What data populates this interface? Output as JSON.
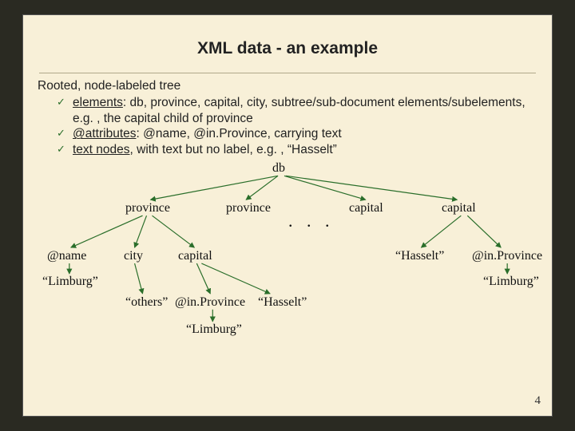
{
  "title": "XML data - an example",
  "lead": "Rooted, node-labeled tree",
  "bullets": [
    {
      "pre": "",
      "u": "elements",
      "post": ": db, province, capital, city, subtree/sub-document elements/subelements, e.g. , the capital child of province"
    },
    {
      "pre": "",
      "u": "@attributes",
      "post": ": @name, @in.Province, carrying text"
    },
    {
      "pre": "",
      "u": "text nodes",
      "post": ", with text but no label, e.g. , “Hasselt”"
    }
  ],
  "tree": {
    "root": "db",
    "level1": [
      "province",
      "province",
      "capital",
      "capital"
    ],
    "ellipsis": ". . .",
    "l2_left": [
      "@name",
      "city",
      "capital"
    ],
    "l2_right": [
      "“Hasselt”",
      "@in.Province"
    ],
    "l3_left_text": "“Limburg”",
    "l3_city_text": "“others”",
    "l3_capital_children": [
      "@in.Province",
      "“Hasselt”"
    ],
    "l4_text": "“Limburg”",
    "r_text": "“Limburg”"
  },
  "page_number": "4"
}
